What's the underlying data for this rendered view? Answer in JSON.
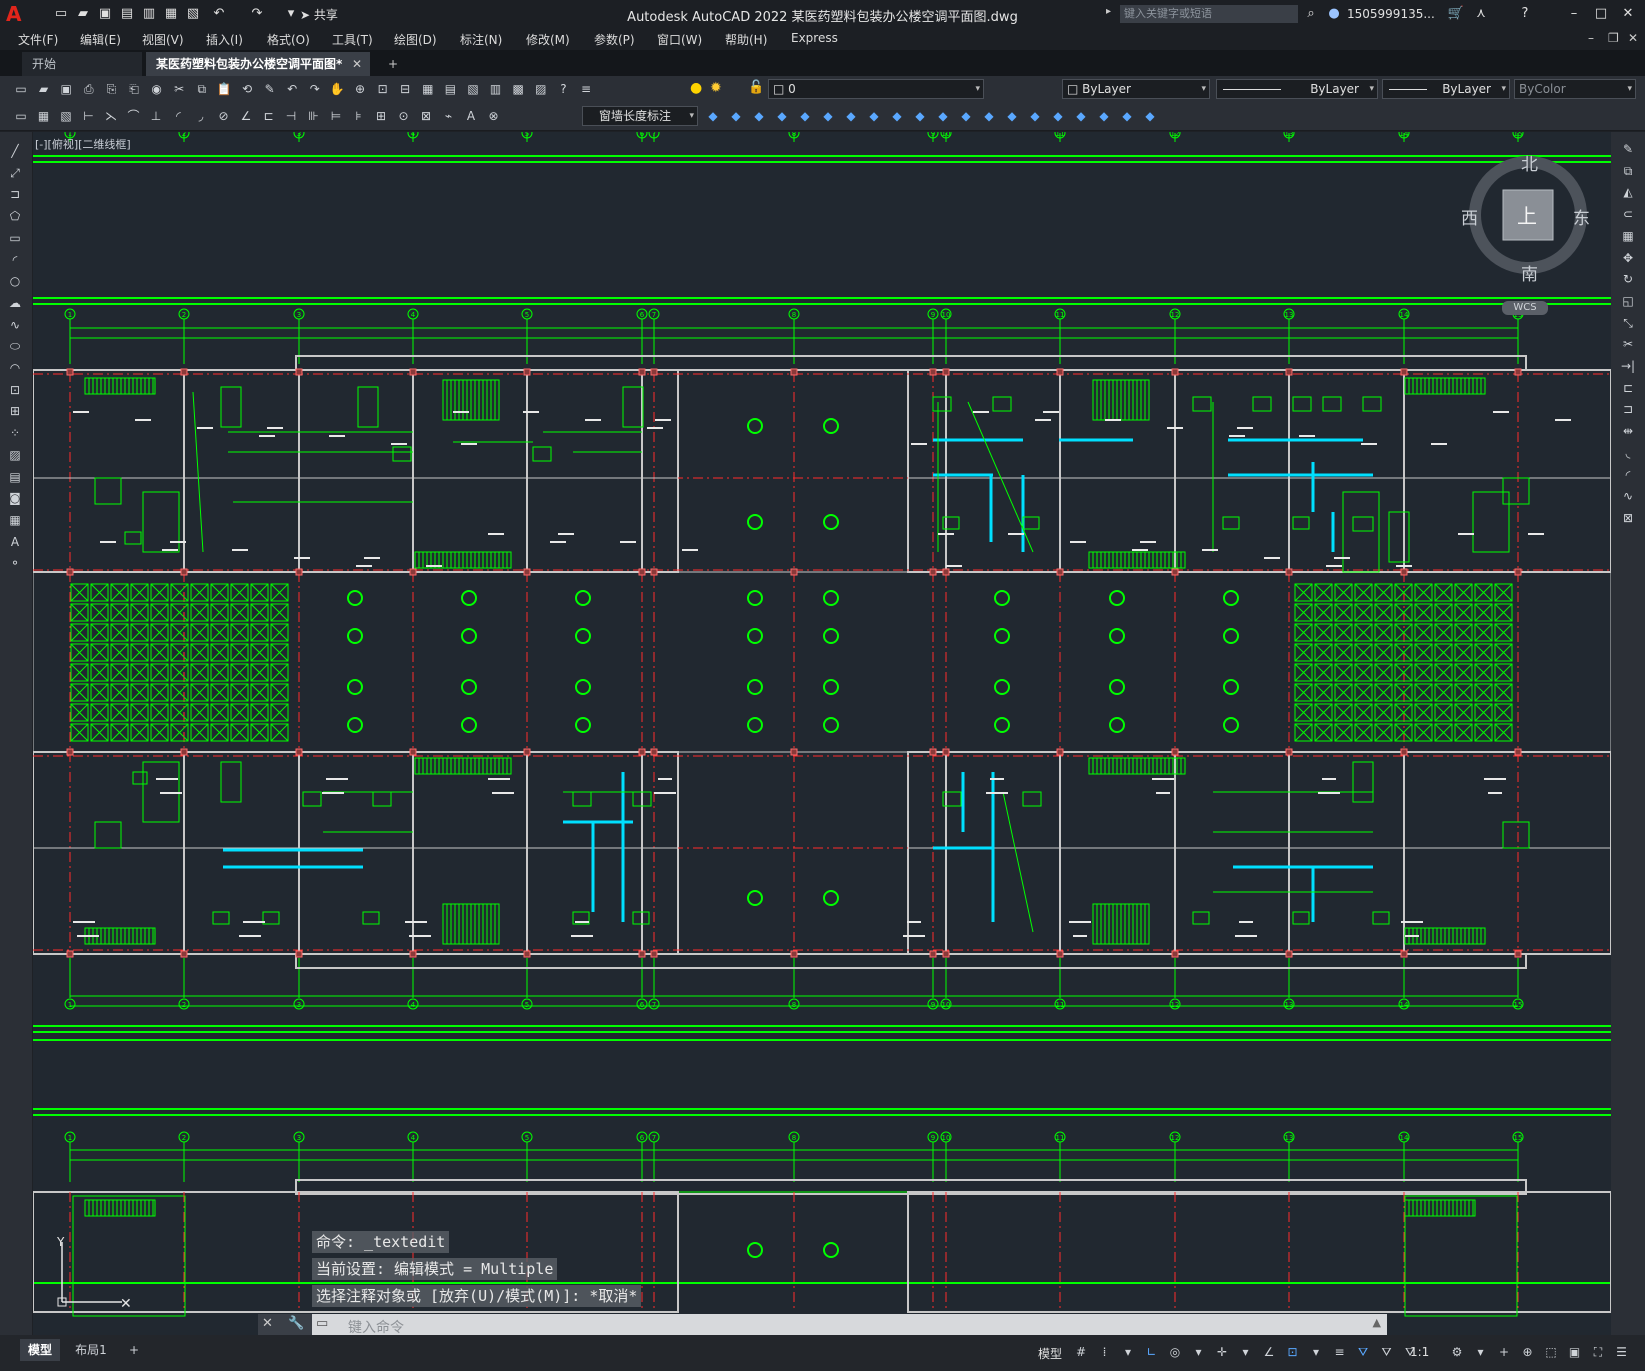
{
  "app": {
    "title": "Autodesk AutoCAD 2022    某医药塑料包装办公楼空调平面图.dwg",
    "logo": "A",
    "share_label": "共享",
    "search_placeholder": "键入关键字或短语",
    "user": "1505999135...",
    "colors": {
      "accent_red": "#e1251b",
      "line_green": "#00ff00",
      "axis_red": "#ff2b2b",
      "duct_cyan": "#00e0ff",
      "wall_gray": "#c8c8c8",
      "canvas": "#212830"
    }
  },
  "menubar": [
    "文件(F)",
    "编辑(E)",
    "视图(V)",
    "插入(I)",
    "格式(O)",
    "工具(T)",
    "绘图(D)",
    "标注(N)",
    "修改(M)",
    "参数(P)",
    "窗口(W)",
    "帮助(H)",
    "Express"
  ],
  "tabs": [
    {
      "label": "开始",
      "active": false
    },
    {
      "label": "某医药塑料包装办公楼空调平面图*",
      "active": true
    }
  ],
  "toolbar": {
    "layer_value": "0",
    "color_value": "ByLayer",
    "linetype_value": "ByLayer",
    "lineweight_value": "ByLayer",
    "plotstyle_value": "ByColor",
    "dimstyle_value": "窗墙长度标注"
  },
  "viewport": {
    "label": "[-][俯视][二维线框]",
    "viewcube": {
      "north": "北",
      "south": "南",
      "east": "东",
      "west": "西",
      "face": "上",
      "wcs": "WCS"
    },
    "grid_labels": [
      "1",
      "2",
      "3",
      "4",
      "5",
      "6",
      "7",
      "8",
      "9",
      "10",
      "11",
      "12",
      "13",
      "14",
      "15"
    ]
  },
  "command": {
    "history": [
      "命令: _textedit",
      "当前设置: 编辑模式 = Multiple",
      "选择注释对象或 [放弃(U)/模式(M)]: *取消*"
    ],
    "placeholder": "键入命令"
  },
  "status": {
    "layout_tabs": [
      "模型",
      "布局1"
    ],
    "model_label": "模型",
    "scale": "1:1"
  }
}
